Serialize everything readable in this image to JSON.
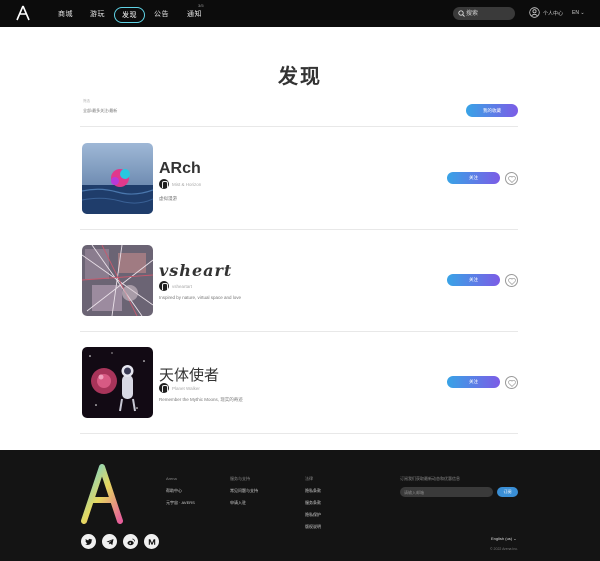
{
  "nav": {
    "items": [
      {
        "label": "商城",
        "active": false
      },
      {
        "label": "游玩",
        "active": false
      },
      {
        "label": "发现",
        "active": true
      },
      {
        "label": "公告",
        "active": false
      },
      {
        "label": "通知",
        "active": false
      }
    ],
    "notice_badge": "3/5",
    "search_placeholder": "搜索",
    "user_label": "个人中心",
    "language": "EN"
  },
  "page": {
    "title": "发现",
    "filter_label": "筛选",
    "filter_value": "全部/最多关注/最新",
    "submit_label": "我的收藏"
  },
  "items": [
    {
      "title": "ARch",
      "author": "Mist & Horizon",
      "description": "虚拟漫游",
      "follow_label": "关注"
    },
    {
      "title": "vsheart",
      "author": "vsheartart",
      "description": "Inspired by nature, virtual space and love",
      "follow_label": "关注"
    },
    {
      "title": "天体使者",
      "author": "Planet Walker",
      "description": "Remember the Mythic Moons, 现实的奇迹",
      "follow_label": "关注"
    }
  ],
  "footer": {
    "col1": {
      "head": "Arena",
      "links": [
        "帮助中心",
        "元宇宙 · AVERS"
      ]
    },
    "col2": {
      "head": "服务与支持",
      "links": [
        "常见问题与支持",
        "申请入驻"
      ]
    },
    "col3": {
      "head": "法律",
      "links": [
        "隐私条款",
        "服务条款",
        "隐私保护",
        "版权说明"
      ]
    },
    "newsletter": {
      "label": "订阅我们获取最新动态和优惠信息",
      "placeholder": "请输入邮箱",
      "button": "订阅"
    },
    "social": [
      "twitter-icon",
      "telegram-icon",
      "weibo-icon",
      "medium-icon"
    ],
    "language": "English (us)",
    "copyright": "© 2022 Arena Inc."
  },
  "colors": {
    "nav_bg": "#0c0c0c",
    "accent_start": "#38a3e6",
    "accent_end": "#7c5ce6",
    "active_border": "#5fd3e6",
    "footer_bg": "#141414"
  }
}
